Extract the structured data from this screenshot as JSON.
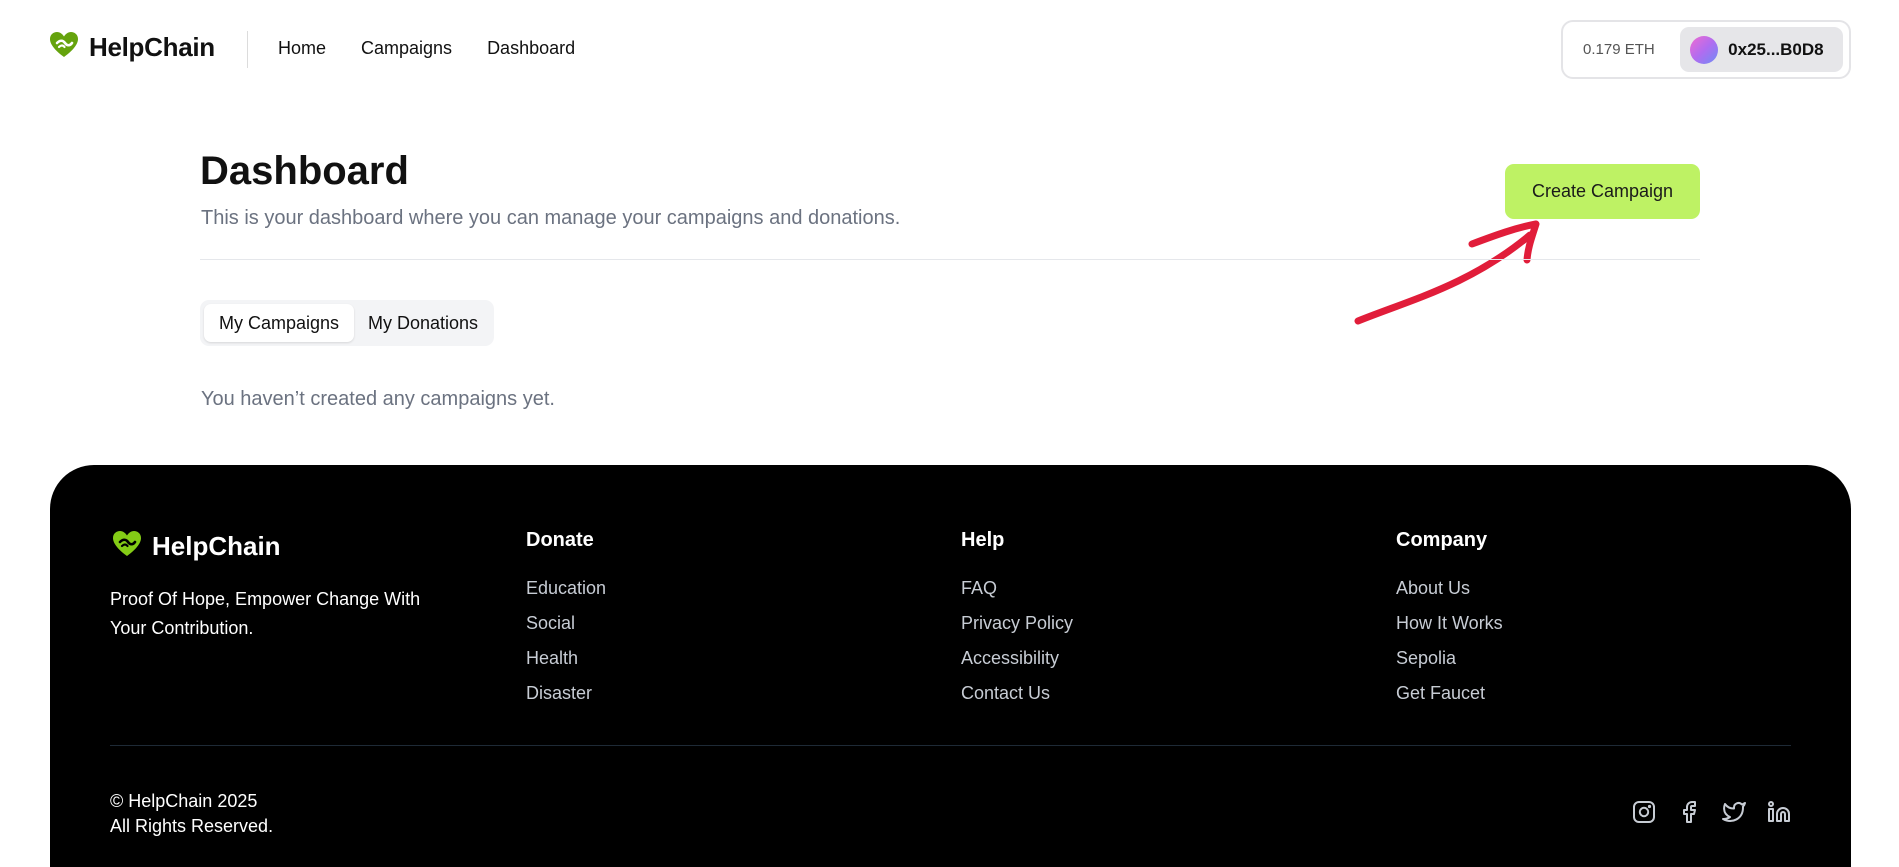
{
  "header": {
    "brand": "HelpChain",
    "nav": [
      "Home",
      "Campaigns",
      "Dashboard"
    ],
    "wallet": {
      "balance": "0.179 ETH",
      "address": "0x25...B0D8"
    }
  },
  "main": {
    "title": "Dashboard",
    "subtitle": "This is your dashboard where you can manage your campaigns and donations.",
    "create_button": "Create Campaign",
    "tabs": [
      "My Campaigns",
      "My Donations"
    ],
    "active_tab": "My Campaigns",
    "empty_message": "You haven’t created any campaigns yet."
  },
  "footer": {
    "brand": "HelpChain",
    "tagline": "Proof Of Hope, Empower Change With Your Contribution.",
    "columns": [
      {
        "title": "Donate",
        "links": [
          "Education",
          "Social",
          "Health",
          "Disaster"
        ]
      },
      {
        "title": "Help",
        "links": [
          "FAQ",
          "Privacy Policy",
          "Accessibility",
          "Contact Us"
        ]
      },
      {
        "title": "Company",
        "links": [
          "About Us",
          "How It Works",
          "Sepolia",
          "Get Faucet"
        ]
      }
    ],
    "copyright_line1": "© HelpChain 2025",
    "copyright_line2": "All Rights Reserved.",
    "socials": [
      "instagram-icon",
      "facebook-icon",
      "twitter-icon",
      "linkedin-icon"
    ]
  },
  "colors": {
    "accent": "#bef264",
    "logo_green": "#65a30d",
    "annotation_arrow": "#e11d3a",
    "muted_text": "#6b7280",
    "footer_bg": "#000000"
  }
}
